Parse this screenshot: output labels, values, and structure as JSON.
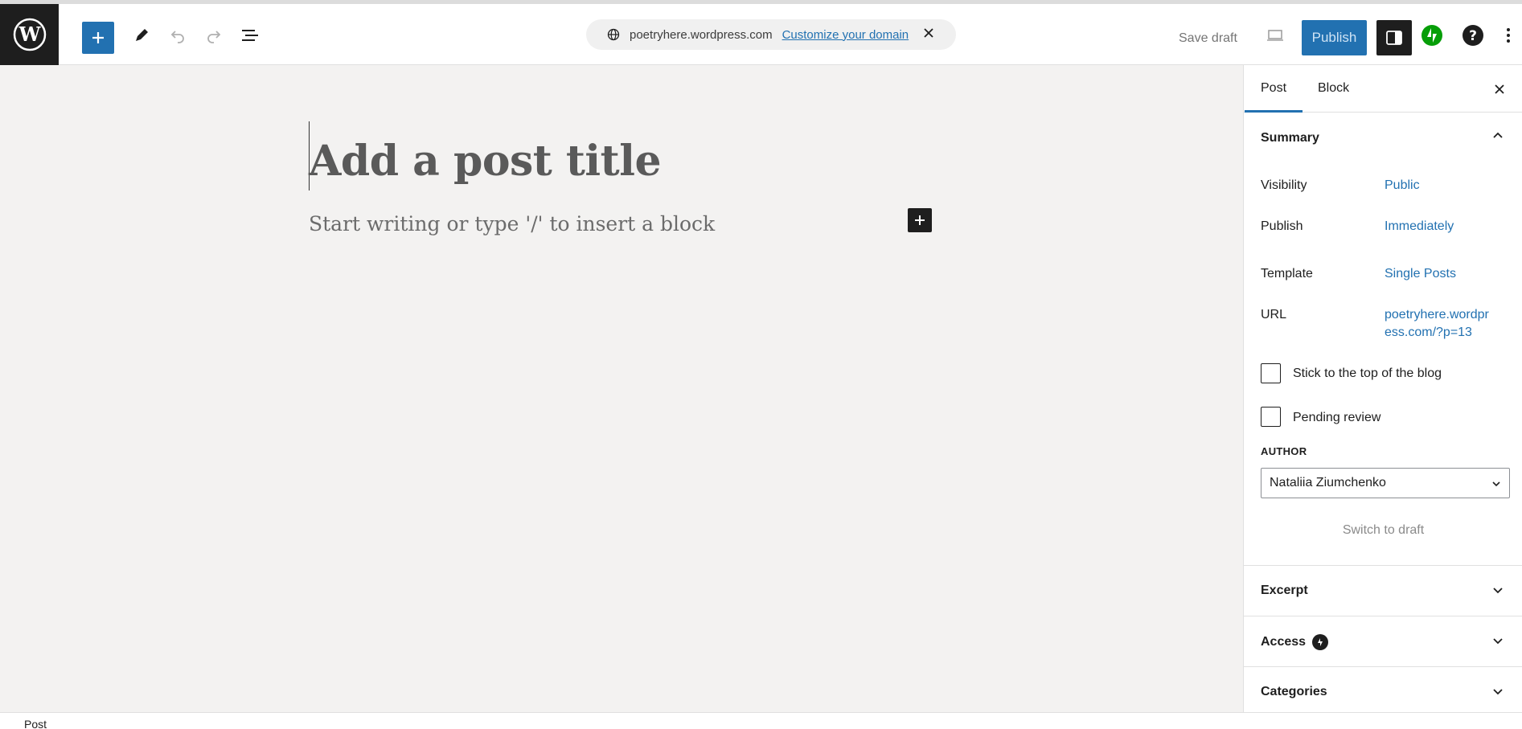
{
  "toolbar": {
    "domain": "poetryhere.wordpress.com",
    "customize_domain": "Customize your domain",
    "save_draft": "Save draft",
    "publish": "Publish"
  },
  "editor": {
    "title_placeholder": "Add a post title",
    "paragraph_placeholder": "Start writing or type '/' to insert a block"
  },
  "sidebar": {
    "tabs": [
      "Post",
      "Block"
    ],
    "summary": {
      "title": "Summary",
      "rows": [
        {
          "label": "Visibility",
          "value": "Public"
        },
        {
          "label": "Publish",
          "value": "Immediately"
        },
        {
          "label": "Template",
          "value": "Single Posts"
        },
        {
          "label": "URL",
          "value_line1": "poetryhere.wordpr",
          "value_line2": "ess.com/?p=13"
        }
      ],
      "checkboxes": [
        {
          "label": "Stick to the top of the blog",
          "checked": false
        },
        {
          "label": "Pending review",
          "checked": false
        }
      ],
      "author_heading": "AUTHOR",
      "author_value": "Nataliia Ziumchenko",
      "switch_to_draft": "Switch to draft"
    },
    "panels": [
      "Excerpt",
      "Access",
      "Categories"
    ]
  },
  "footer": {
    "breadcrumb": "Post"
  },
  "colors": {
    "accent": "#2271b1",
    "jetpack_green": "#069e08",
    "dark": "#1e1e1e"
  }
}
